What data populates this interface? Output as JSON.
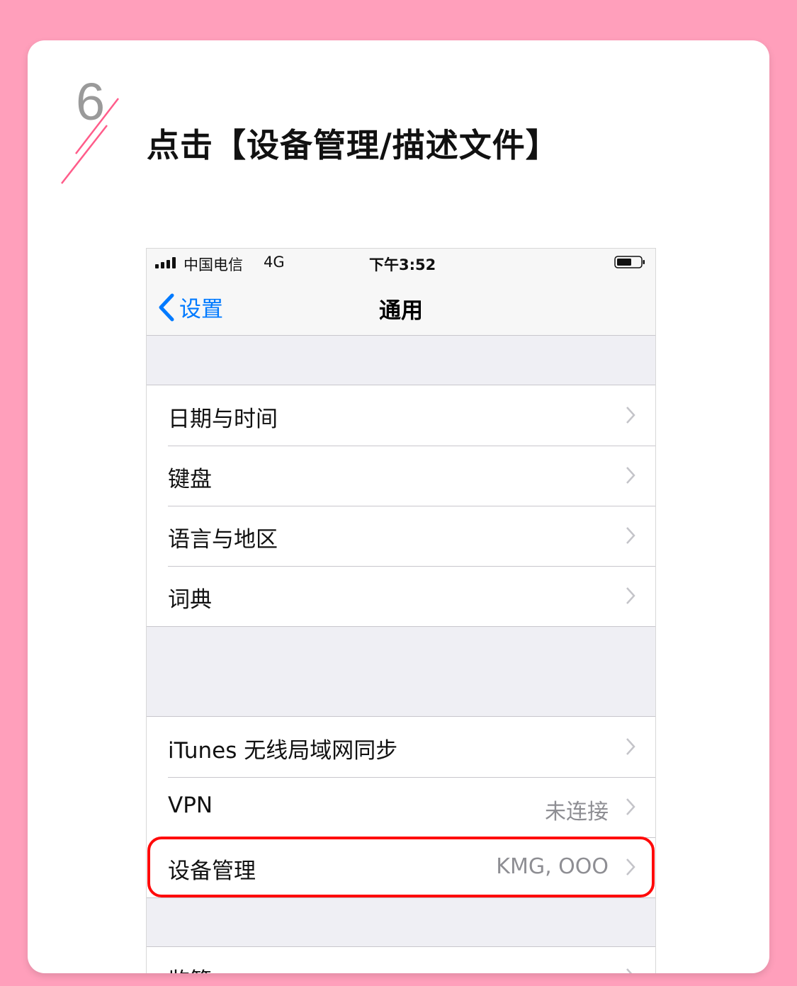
{
  "step": {
    "number": "6",
    "title": "点击【设备管理/描述文件】",
    "accent_color": "#ff5c8a"
  },
  "status_bar": {
    "carrier": "中国电信",
    "network": "4G",
    "time": "下午3:52",
    "signal_icon": "signal-bars-icon",
    "battery_icon": "battery-icon"
  },
  "nav": {
    "back_label": "设置",
    "title": "通用",
    "accent_color": "#007aff"
  },
  "groups": [
    {
      "rows": [
        {
          "label": "日期与时间",
          "detail": ""
        },
        {
          "label": "键盘",
          "detail": ""
        },
        {
          "label": "语言与地区",
          "detail": ""
        },
        {
          "label": "词典",
          "detail": ""
        }
      ]
    },
    {
      "rows": [
        {
          "label": "iTunes 无线局域网同步",
          "detail": ""
        },
        {
          "label": "VPN",
          "detail": "未连接"
        },
        {
          "label": "设备管理",
          "detail": "KMG, OOO"
        }
      ]
    },
    {
      "rows": [
        {
          "label": "监管",
          "detail": ""
        }
      ]
    }
  ],
  "highlight_color": "#ff0a0a"
}
